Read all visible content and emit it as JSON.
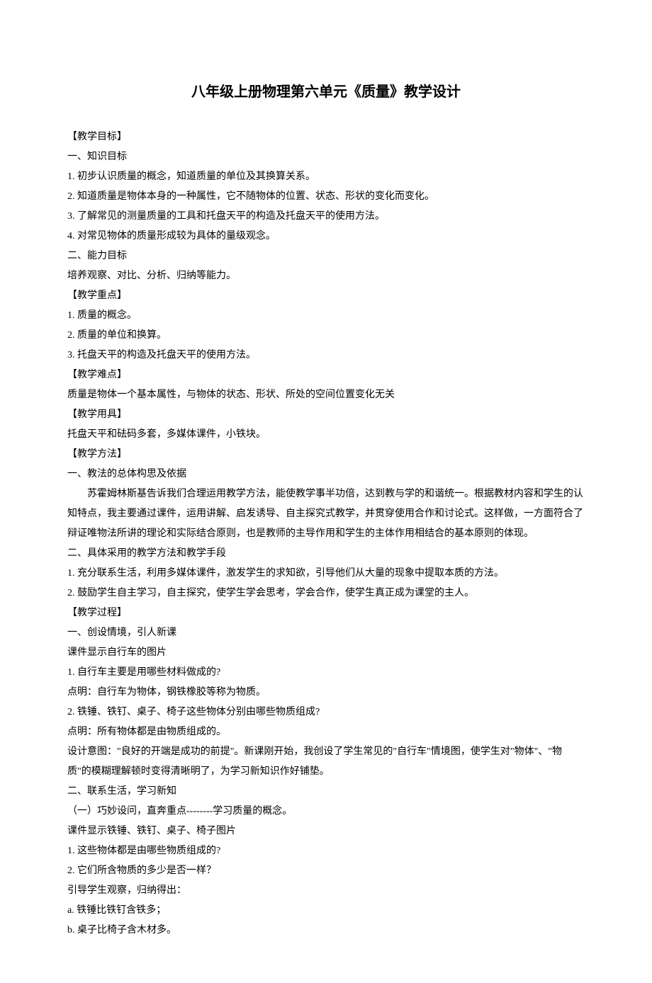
{
  "title": "八年级上册物理第六单元《质量》教学设计",
  "lines": [
    "【教学目标】",
    "一、知识目标",
    "1. 初步认识质量的概念，知道质量的单位及其换算关系。",
    "2. 知道质量是物体本身的一种属性，它不随物体的位置、状态、形状的变化而变化。",
    "3. 了解常见的测量质量的工具和托盘天平的构造及托盘天平的使用方法。",
    "4. 对常见物体的质量形成较为具体的量级观念。",
    "二、能力目标",
    "培养观察、对比、分析、归纳等能力。",
    "【教学重点】",
    "1. 质量的概念。",
    "2. 质量的单位和换算。",
    "3. 托盘天平的构造及托盘天平的使用方法。",
    "【教学难点】",
    "质量是物体一个基本属性，与物体的状态、形状、所处的空间位置变化无关",
    "【教学用具】",
    "托盘天平和砝码多套，多媒体课件，小铁块。",
    "【教学方法】",
    "一、教法的总体构思及依据",
    "　　苏霍姆林斯基告诉我们合理运用教学方法，能使教学事半功倍，达到教与学的和谐统一。根据教材内容和学生的认知特点，我主要通过课件，运用讲解、启发诱导、自主探究式教学，并贯穿使用合作和讨论式。这样做，一方面符合了辩证唯物法所讲的理论和实际结合原则，也是教师的主导作用和学生的主体作用相结合的基本原则的体现。",
    "二、具体采用的教学方法和教学手段",
    "1. 充分联系生活，利用多媒体课件，激发学生的求知欲，引导他们从大量的现象中提取本质的方法。",
    "2. 鼓励学生自主学习，自主探究，使学生学会思考，学会合作，使学生真正成为课堂的主人。",
    "【教学过程】",
    "一、创设情境，引人新课",
    "课件显示自行车的图片",
    "1. 自行车主要是用哪些材料做成的?",
    "点明：自行车为物体，钢铁橡胶等称为物质。",
    "2. 铁锤、铁钉、桌子、椅子这些物体分别由哪些物质组成?",
    "点明：所有物体都是由物质组成的。",
    "设计意图：\"良好的开端是成功的前提\"。新课刚开始，我创设了学生常见的\"自行车\"情境图，使学生对\"物体\"、\"物质\"的模糊理解顿时变得清晰明了，为学习新知识作好铺垫。",
    "二、联系生活，学习新知",
    "（一）巧妙设问，直奔重点--------学习质量的概念。",
    "课件显示铁锤、铁钉、桌子、椅子图片",
    "1. 这些物体都是由哪些物质组成的?",
    "2. 它们所含物质的多少是否一样？",
    "引导学生观察，归纳得出：",
    "a. 铁锤比铁钉含铁多；",
    "b. 桌子比椅子含木材多。"
  ]
}
